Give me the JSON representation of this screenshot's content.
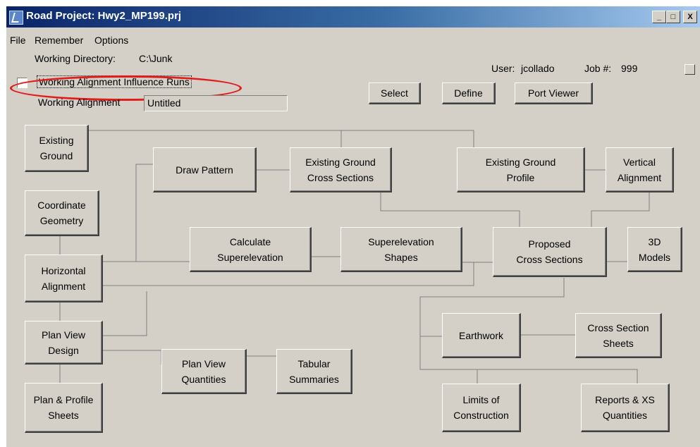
{
  "window": {
    "title": "Road Project: Hwy2_MP199.prj",
    "controls": {
      "minimize": "_",
      "maximize": "□",
      "close": "X"
    }
  },
  "menu": {
    "file": "File",
    "remember": "Remember",
    "options": "Options"
  },
  "info": {
    "working_directory_label": "Working Directory:",
    "working_directory_value": "C:\\Junk",
    "influence_label": "Working Alignment Influence Runs",
    "working_alignment_label": "Working Alignment",
    "working_alignment_value": "Untitled",
    "user_label": "User:",
    "user_value": "jcollado",
    "job_label": "Job #:",
    "job_value": "999"
  },
  "buttons": {
    "select": "Select",
    "define": "Define",
    "port_viewer": "Port Viewer"
  },
  "nodes": {
    "existing_ground": "Existing\nGround",
    "draw_pattern": "Draw Pattern",
    "eg_cross_sections": "Existing Ground\nCross Sections",
    "eg_profile": "Existing Ground\nProfile",
    "vertical_alignment": "Vertical\nAlignment",
    "coordinate_geometry": "Coordinate\nGeometry",
    "calculate_superelevation": "Calculate\nSuperelevation",
    "superelevation_shapes": "Superelevation\nShapes",
    "proposed_cross_sections": "Proposed\nCross Sections",
    "models_3d": "3D\nModels",
    "horizontal_alignment": "Horizontal\nAlignment",
    "plan_view_design": "Plan View\nDesign",
    "earthwork": "Earthwork",
    "cross_section_sheets": "Cross Section\nSheets",
    "plan_view_quantities": "Plan View\nQuantities",
    "tabular_summaries": "Tabular\nSummaries",
    "plan_profile_sheets": "Plan & Profile\nSheets",
    "limits_of_construction": "Limits of\nConstruction",
    "reports_xs_quantities": "Reports & XS\nQuantities"
  },
  "colors": {
    "highlight": "#e21b1b",
    "window_bg": "#d4d0c8",
    "title_start": "#0a246a"
  }
}
